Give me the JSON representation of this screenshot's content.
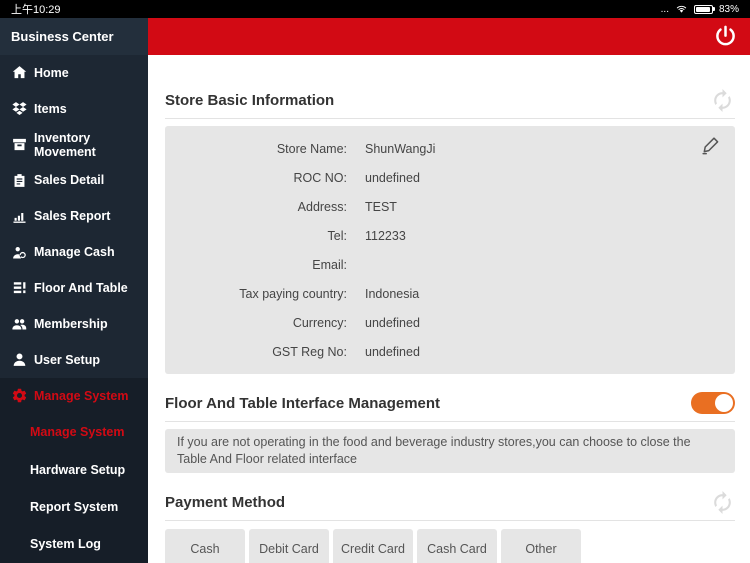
{
  "status_bar": {
    "time": "上午10:29",
    "more": "...",
    "battery_pct": "83%"
  },
  "sidebar": {
    "title": "Business Center",
    "items": [
      {
        "label": "Home",
        "icon": "home-icon"
      },
      {
        "label": "Items",
        "icon": "items-icon"
      },
      {
        "label": "Inventory Movement",
        "icon": "inventory-icon"
      },
      {
        "label": "Sales Detail",
        "icon": "clipboard-icon"
      },
      {
        "label": "Sales Report",
        "icon": "bar-chart-icon"
      },
      {
        "label": "Manage Cash",
        "icon": "cash-person-icon"
      },
      {
        "label": "Floor And Table",
        "icon": "list-alert-icon"
      },
      {
        "label": "Membership",
        "icon": "people-icon"
      },
      {
        "label": "User Setup",
        "icon": "person-icon"
      },
      {
        "label": "Manage System",
        "icon": "gear-icon",
        "active": true
      }
    ],
    "subitems": [
      {
        "label": "Manage System",
        "active": true
      },
      {
        "label": "Hardware Setup"
      },
      {
        "label": "Report System"
      },
      {
        "label": "System Log"
      }
    ]
  },
  "appbar": {
    "power_icon": "power-icon"
  },
  "store_info": {
    "title": "Store Basic Information",
    "fields": [
      {
        "label": "Store Name:",
        "value": "ShunWangJi"
      },
      {
        "label": "ROC NO:",
        "value": "undefined"
      },
      {
        "label": "Address:",
        "value": "TEST"
      },
      {
        "label": "Tel:",
        "value": "112233"
      },
      {
        "label": "Email:",
        "value": ""
      },
      {
        "label": "Tax paying country:",
        "value": "Indonesia"
      },
      {
        "label": "Currency:",
        "value": "undefined"
      },
      {
        "label": "GST Reg No:",
        "value": "undefined"
      }
    ]
  },
  "floor_table": {
    "title": "Floor And Table Interface Management",
    "toggle_state": "on",
    "note": "If you are not operating in the food and beverage industry stores,you can choose to close the Table And Floor related interface"
  },
  "payment": {
    "title": "Payment Method",
    "methods": [
      {
        "label": "Cash"
      },
      {
        "label": "Debit Card"
      },
      {
        "label": "Credit Card"
      },
      {
        "label": "Cash Card"
      },
      {
        "label": "Other"
      }
    ]
  },
  "colors": {
    "accent-red": "#d20a14",
    "toggle-orange": "#e96f22",
    "sidebar-bg": "#1d2733",
    "sidebar-header-bg": "#232f3c",
    "sidebar-active-bg": "#161e28",
    "panel-gray": "#e6e6e6",
    "status-bg": "#000000"
  }
}
